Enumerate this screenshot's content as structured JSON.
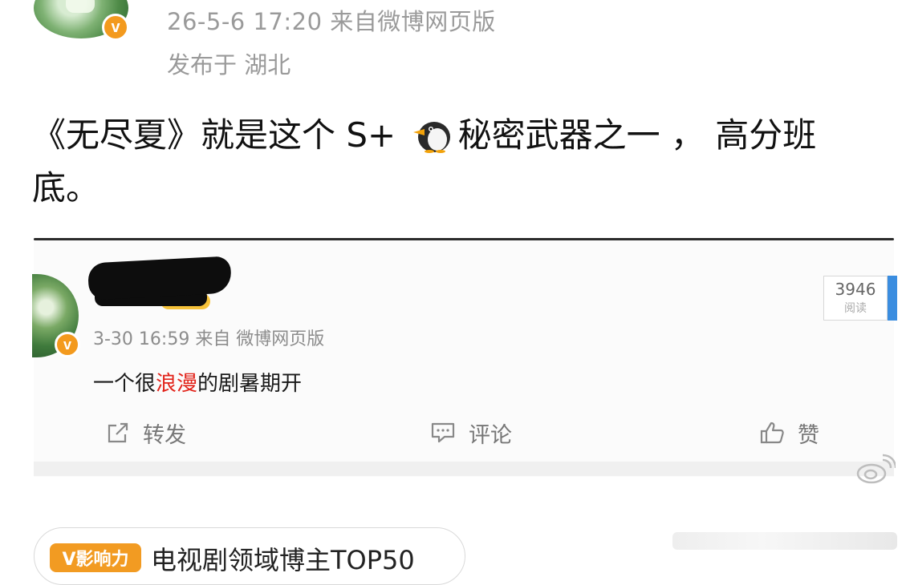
{
  "post": {
    "time_source": "26-5-6 17:20  来自微博网页版",
    "location": "发布于 湖北",
    "text_before": "《无尽夏》就是这个 S+ ",
    "text_after": "秘密武器之一 ， 高分班底。",
    "emoji": "penguin-icon"
  },
  "quote": {
    "time_source": "3-30 16:59 来自 微博网页版",
    "text_part1": "一个很",
    "text_highlight": "浪漫",
    "text_part2": "的剧暑期开",
    "read_count": "3946",
    "read_label": "阅读"
  },
  "actions": {
    "repost": "转发",
    "comment": "评论",
    "like": "赞"
  },
  "tag": {
    "badge": "V影响力",
    "text": "电视剧领域博主TOP50"
  },
  "colors": {
    "badge_orange": "#f39a1e",
    "highlight_red": "#e2231a",
    "meta_gray": "#9a9a9a"
  }
}
